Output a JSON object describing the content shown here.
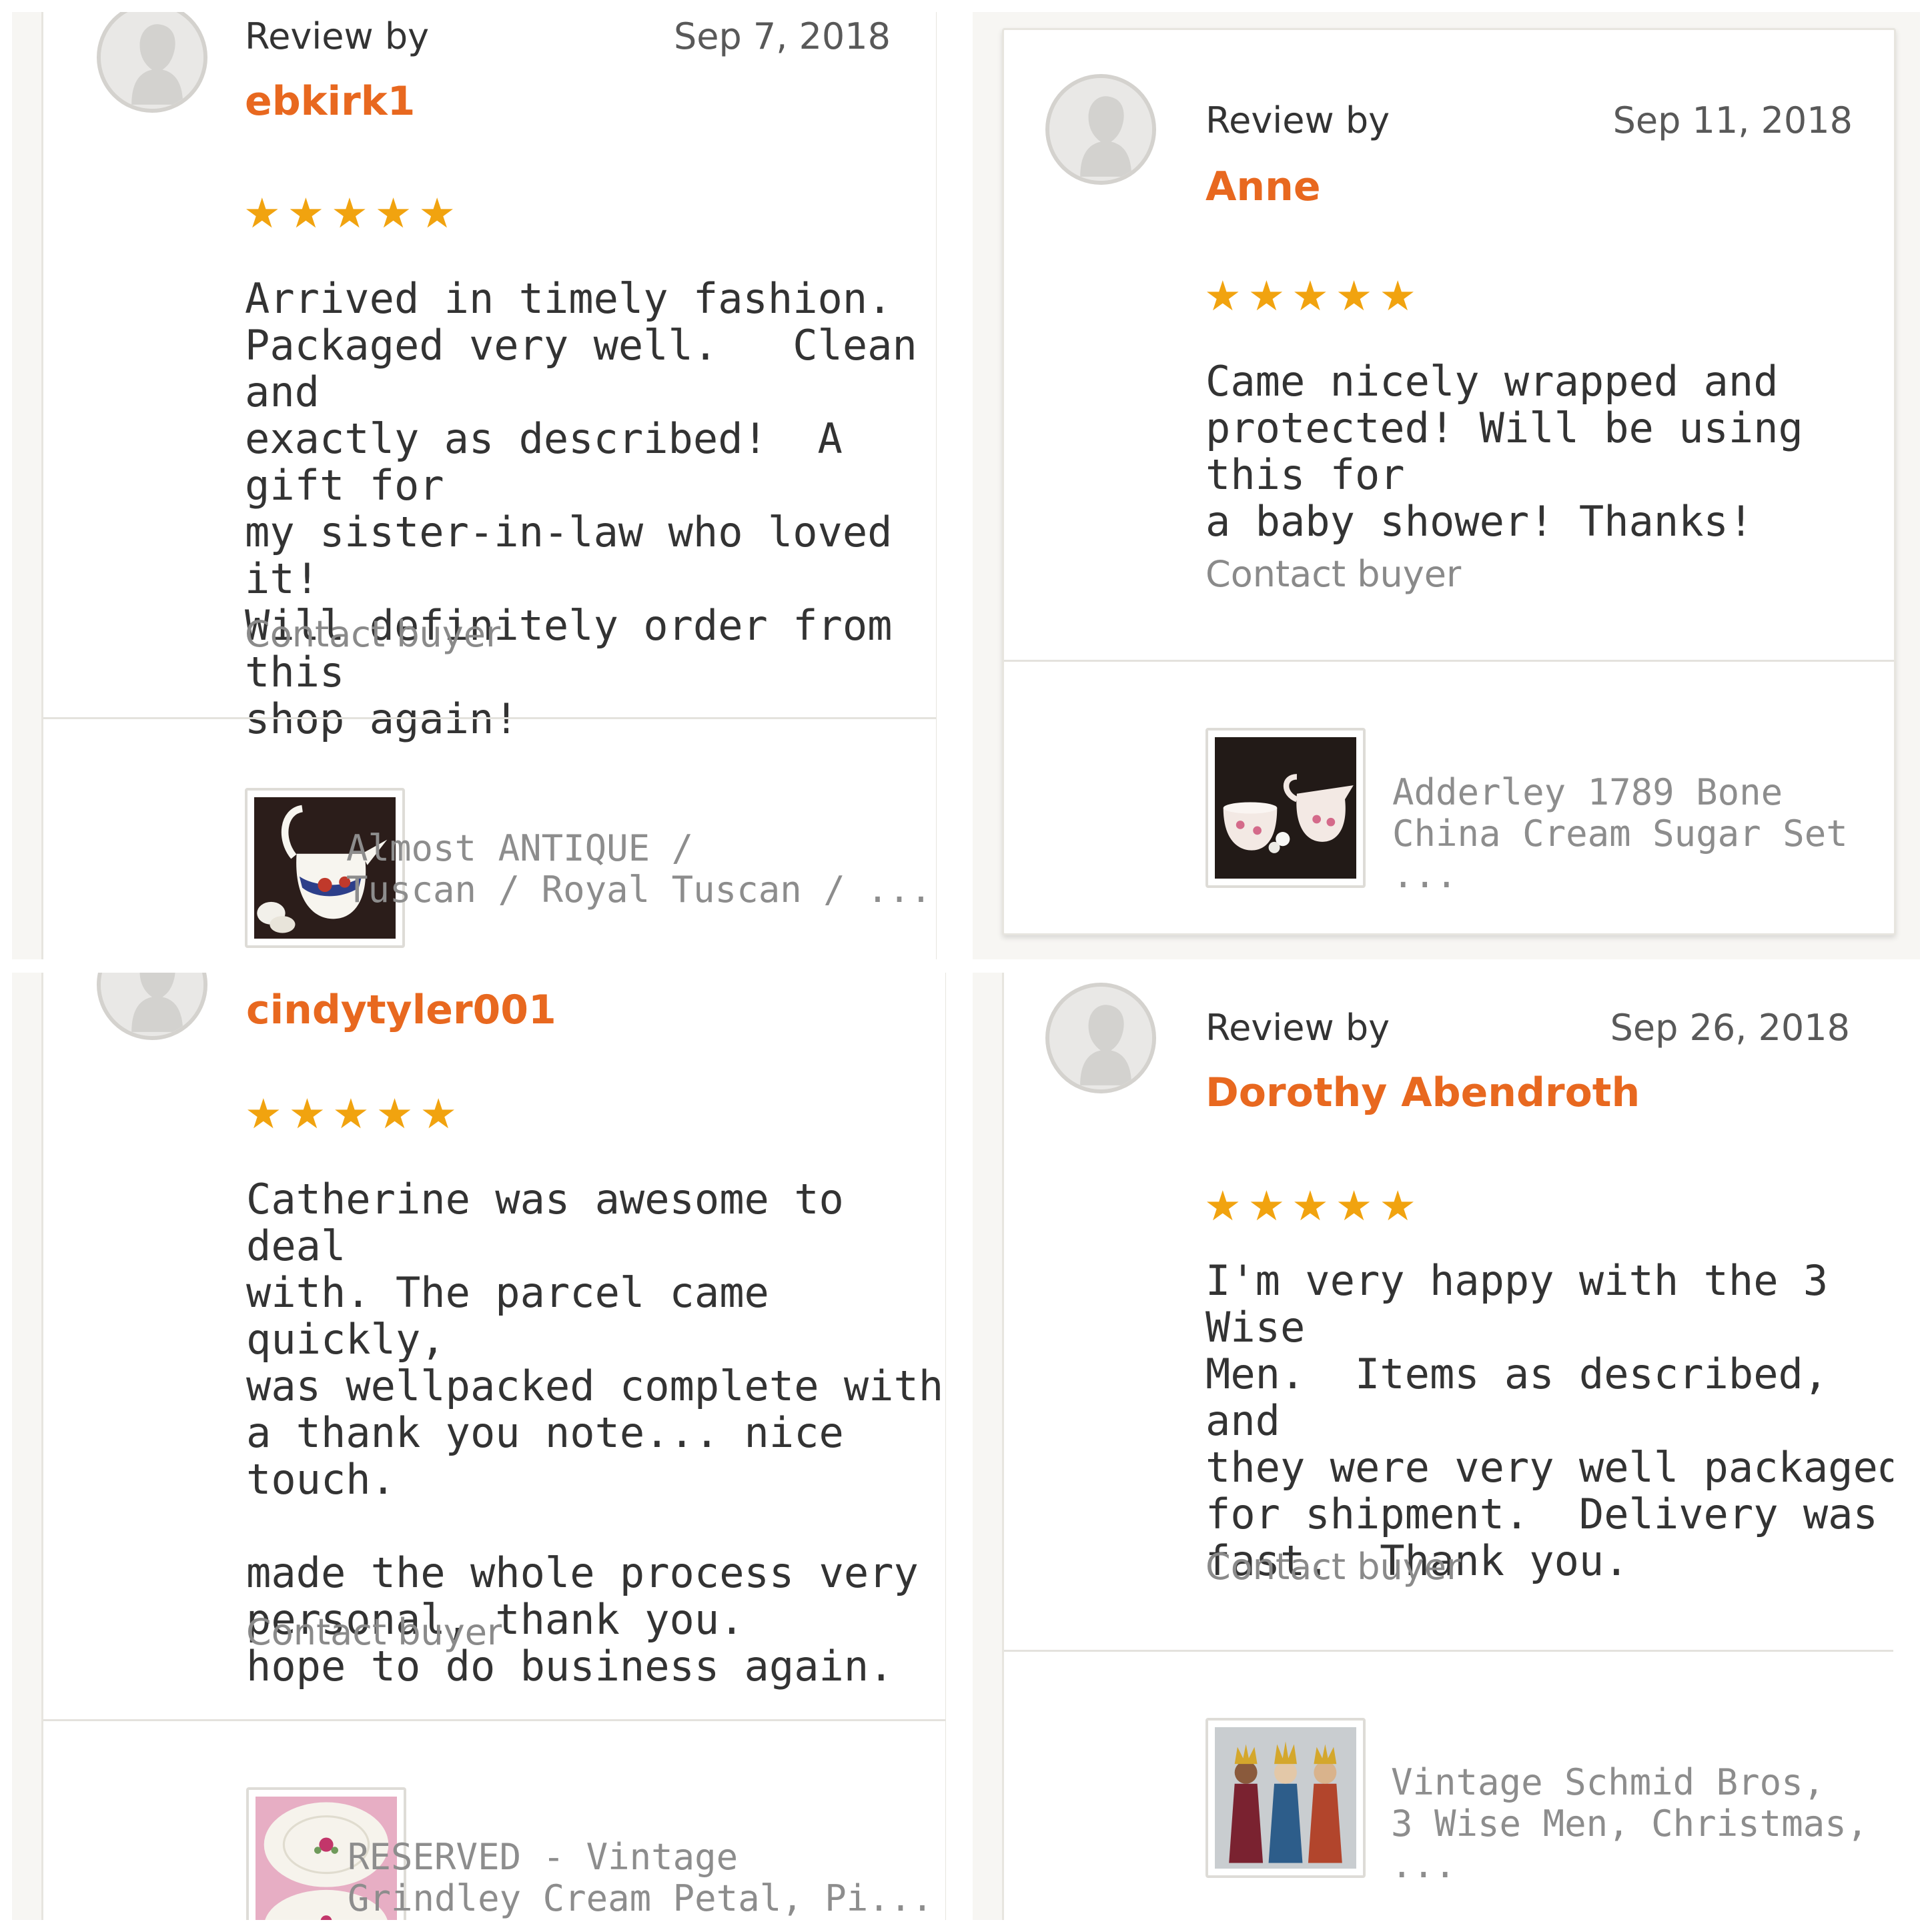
{
  "reviews": [
    {
      "review_by_label": "Review by",
      "date": "Sep 7, 2018",
      "reviewer": "ebkirk1",
      "rating": 5,
      "stars": "★★★★★",
      "text": "Arrived in timely fashion.\nPackaged very well.   Clean and\nexactly as described!  A gift for\nmy sister-in-law who loved it!\nWill definitely order from this\nshop again!",
      "contact_label": "Contact buyer",
      "listing_title": "Almost ANTIQUE /\nTuscan / Royal Tuscan / ...",
      "thumbnail_icon": "creamer-pitcher-photo"
    },
    {
      "review_by_label": "Review by",
      "date": "Sep 11, 2018",
      "reviewer": "Anne",
      "rating": 5,
      "stars": "★★★★★",
      "text": "Came nicely wrapped and\nprotected! Will be using this for\na baby shower! Thanks!",
      "contact_label": "Contact buyer",
      "listing_title": "Adderley 1789 Bone\nChina Cream Sugar Set ...",
      "thumbnail_icon": "cream-sugar-set-photo"
    },
    {
      "reviewer": "cindytyler001",
      "rating": 5,
      "stars": "★★★★★",
      "text": "Catherine was awesome to deal\nwith. The parcel came quickly,\nwas wellpacked complete with\na thank you note... nice touch.\n\nmade the whole process very\npersonal, thank you.\nhope to do business again.",
      "contact_label": "Contact buyer",
      "listing_title": "RESERVED - Vintage\nGrindley Cream Petal, Pi...",
      "thumbnail_icon": "floral-plates-photo"
    },
    {
      "review_by_label": "Review by",
      "date": "Sep 26, 2018",
      "reviewer": "Dorothy Abendroth",
      "rating": 5,
      "stars": "★★★★★",
      "text": "I'm very happy with the 3 Wise\nMen.  Items as described, and\nthey were very well packaged\nfor shipment.  Delivery was\nfast.  Thank you.",
      "contact_label": "Contact buyer",
      "listing_title": "Vintage Schmid Bros,\n3 Wise Men, Christmas, ...",
      "thumbnail_icon": "three-wise-men-photo"
    }
  ],
  "colors": {
    "reviewer_name": "#e8681f",
    "stars": "#f1a30f",
    "muted_text": "#8a8a8a",
    "body_text": "#333333"
  }
}
